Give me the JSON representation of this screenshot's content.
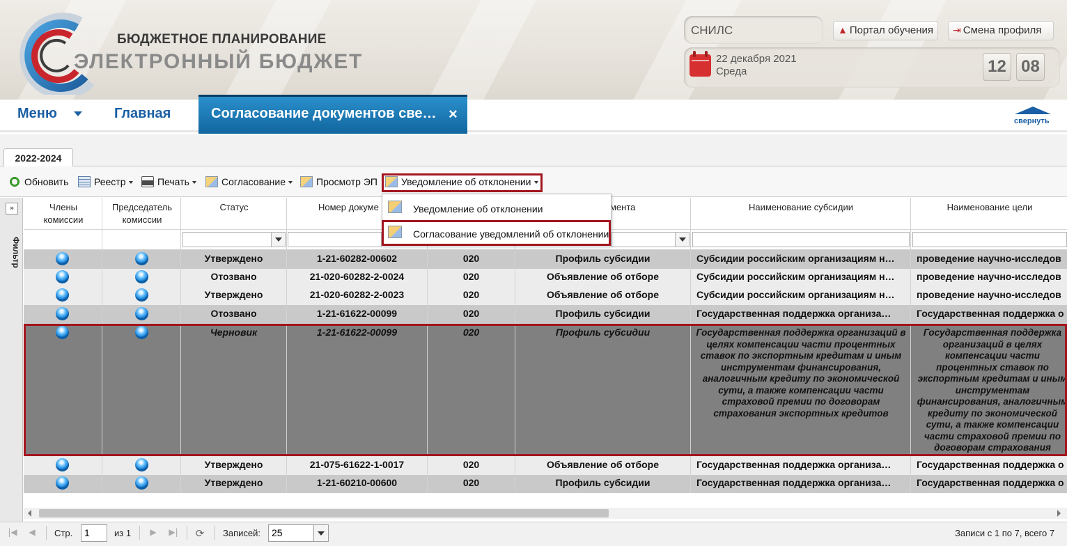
{
  "header": {
    "brand_top": "БЮДЖЕТНОЕ ПЛАНИРОВАНИЕ",
    "brand_main": "ЭЛЕКТРОННЫЙ БЮДЖЕТ",
    "snils_placeholder": "СНИЛС",
    "date": "22 декабря 2021",
    "weekday": "Среда",
    "portal_button": "Портал обучения",
    "switch_profile_button": "Смена профиля",
    "clock_hours": "12",
    "clock_minutes": "08"
  },
  "nav": {
    "menu": "Меню",
    "home": "Главная",
    "active_tab": "Согласование документов све…",
    "close": "×",
    "collapse": "свернуть"
  },
  "year_tab": "2022-2024",
  "toolbar": {
    "refresh": "Обновить",
    "registry": "Реестр",
    "print": "Печать",
    "approval": "Согласование",
    "view_signature": "Просмотр ЭП",
    "rejection_notice": "Уведомление об отклонении"
  },
  "dropdown": {
    "items": [
      "Уведомление об отклонении",
      "Согласование уведомлений об отклонении"
    ]
  },
  "filter_panel": {
    "label": "Фильтр",
    "toggle": "»"
  },
  "grid": {
    "columns": [
      "Члены комиссии",
      "Председатель комиссии",
      "Статус",
      "Номер докуме",
      "",
      "мента",
      "Наименование субсидии",
      "Наименование цели"
    ],
    "rows": [
      {
        "status": "Утверждено",
        "number": "1-21-60282-00602",
        "code": "020",
        "doc_type": "Профиль субсидии",
        "subsidy": "Субсидии российским организациям н…",
        "goal": "проведение научно-исследов"
      },
      {
        "status": "Отозвано",
        "number": "21-020-60282-2-0024",
        "code": "020",
        "doc_type": "Объявление об отборе",
        "subsidy": "Субсидии российским организациям н…",
        "goal": "проведение научно-исследов"
      },
      {
        "status": "Утверждено",
        "number": "21-020-60282-2-0023",
        "code": "020",
        "doc_type": "Объявление об отборе",
        "subsidy": "Субсидии российским организациям н…",
        "goal": "проведение научно-исследов"
      },
      {
        "status": "Отозвано",
        "number": "1-21-61622-00099",
        "code": "020",
        "doc_type": "Профиль субсидии",
        "subsidy": "Государственная поддержка организа…",
        "goal": "Государственная поддержка о"
      },
      {
        "status": "Черновик",
        "number": "1-21-61622-00099",
        "code": "020",
        "doc_type": "Профиль субсидии",
        "subsidy": "Государственная поддержка организаций в целях компенсации части процентных ставок по экспортным кредитам и иным инструментам финансирования, аналогичным кредиту по экономической сути, а также компенсации части страховой премии по договорам страхования экспортных кредитов",
        "goal": "Государственная поддержка организаций в целях компенсации части процентных ставок по экспортным кредитам и иным инструментам финансирования, аналогичным кредиту по экономической сути, а также компенсации части страховой премии по договорам страхования экспортных кредитов"
      },
      {
        "status": "Утверждено",
        "number": "21-075-61622-1-0017",
        "code": "020",
        "doc_type": "Объявление об отборе",
        "subsidy": "Государственная поддержка организа…",
        "goal": "Государственная поддержка о"
      },
      {
        "status": "Утверждено",
        "number": "1-21-60210-00600",
        "code": "020",
        "doc_type": "Профиль субсидии",
        "subsidy": "Государственная поддержка организа…",
        "goal": "Государственная поддержка о"
      }
    ]
  },
  "footer": {
    "page_label": "Стр.",
    "page_value": "1",
    "of_label": "из 1",
    "records_label": "Записей:",
    "records_value": "25",
    "summary": "Записи с 1 по 7, всего 7"
  }
}
